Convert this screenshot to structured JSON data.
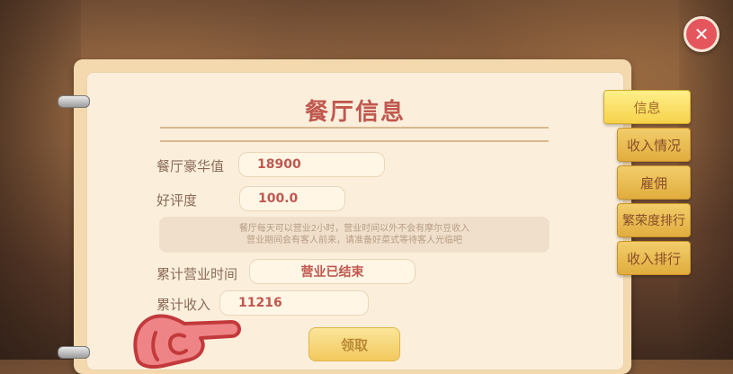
{
  "close_button": {
    "glyph": "✕"
  },
  "panel": {
    "title": "餐厅信息",
    "fields": [
      {
        "label": "餐厅豪华值",
        "value": "18900"
      },
      {
        "label": "好评度",
        "value": "100.0"
      }
    ],
    "notice_line1": "餐厅每天可以营业2小时，营业时间以外不会有摩尔豆收入",
    "notice_line2": "营业期间会有客人前来，请准备好菜式等待客人光临吧",
    "business_time": {
      "label": "累计营业时间",
      "value": "营业已结束"
    },
    "income": {
      "label": "累计收入",
      "value": "11216"
    },
    "claim_label": "领取"
  },
  "tabs": [
    {
      "label": "信息",
      "active": true
    },
    {
      "label": "收入情况",
      "active": false
    },
    {
      "label": "雇佣",
      "active": false
    },
    {
      "label": "繁荣度排行",
      "active": false
    },
    {
      "label": "收入排行",
      "active": false
    }
  ],
  "colors": {
    "title": "#c0584f",
    "tab": "#e1ad3e",
    "close": "#e5555c"
  }
}
